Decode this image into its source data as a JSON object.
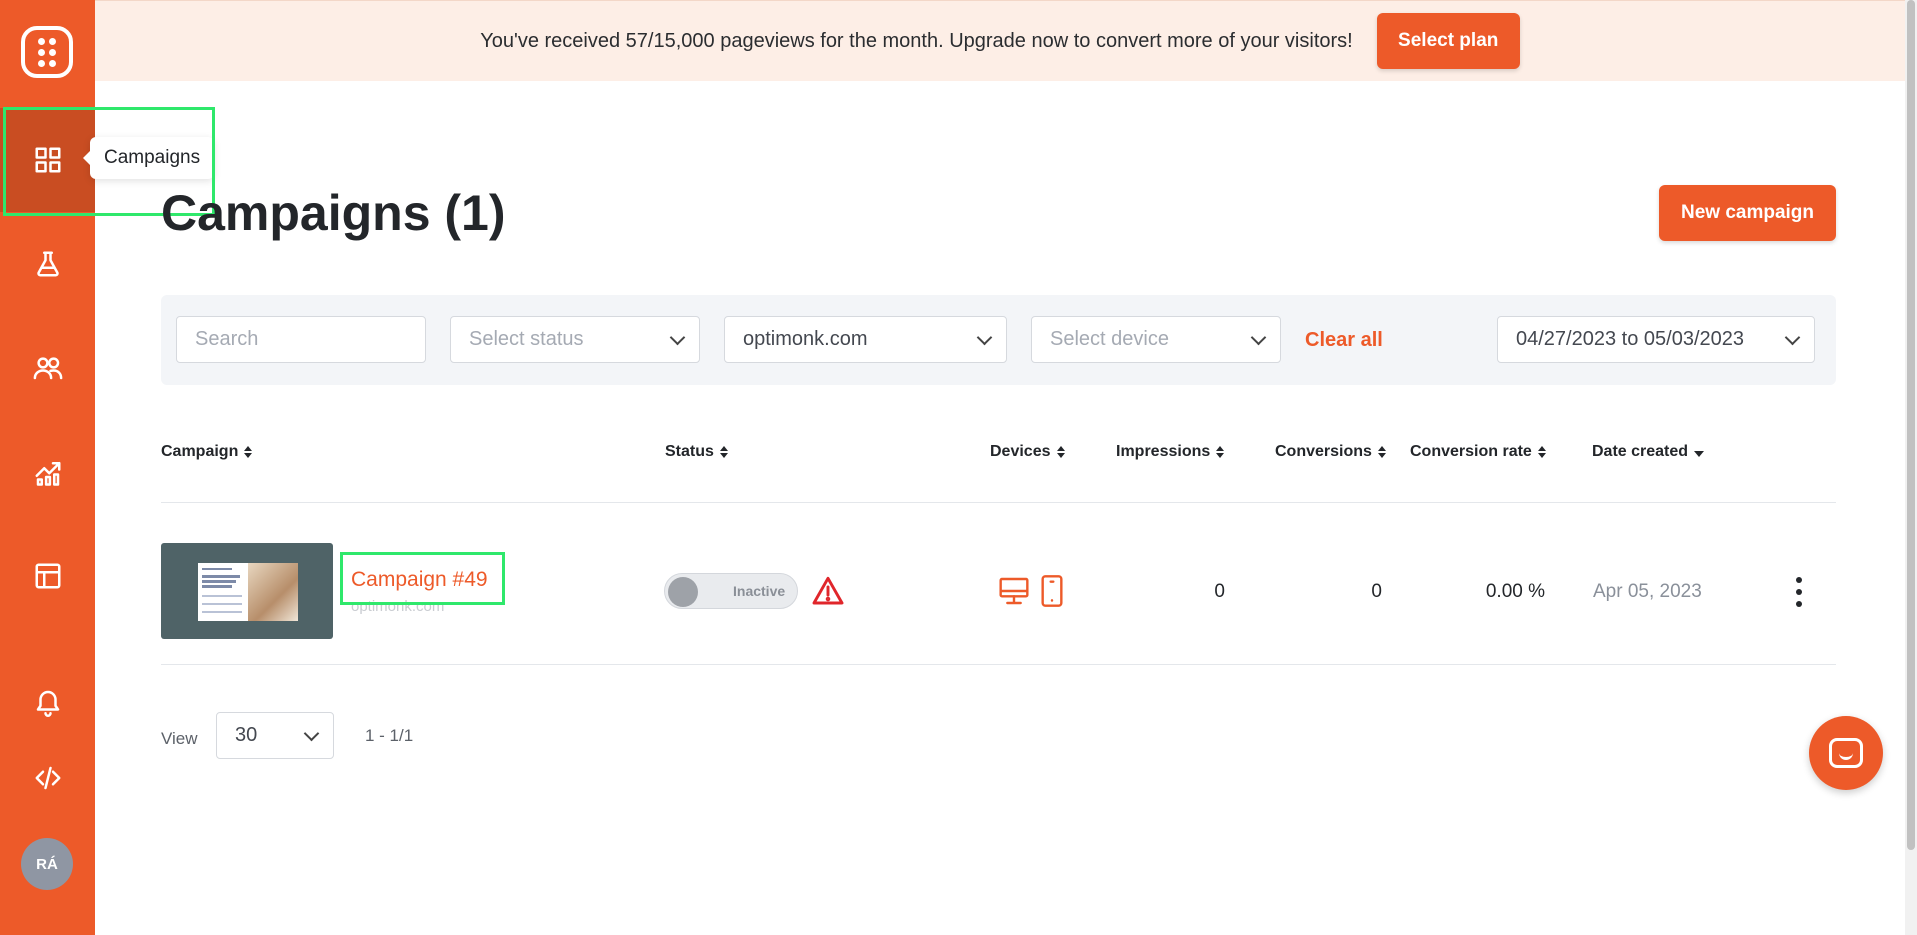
{
  "banner": {
    "message": "You've received 57/15,000 pageviews for the month. Upgrade now to convert more of your visitors!",
    "cta_label": "Select plan"
  },
  "sidebar": {
    "items": [
      {
        "icon": "grid-icon",
        "label": "Campaigns",
        "active": true
      },
      {
        "icon": "flask-icon"
      },
      {
        "icon": "users-icon"
      },
      {
        "icon": "analytics-icon"
      },
      {
        "icon": "layout-icon"
      },
      {
        "icon": "bell-icon"
      },
      {
        "icon": "code-icon"
      }
    ],
    "tooltip": "Campaigns",
    "avatar_initials": "RÁ"
  },
  "header": {
    "title": "Campaigns (1)",
    "new_campaign_label": "New campaign"
  },
  "filters": {
    "search_placeholder": "Search",
    "status_placeholder": "Select status",
    "domain_value": "optimonk.com",
    "device_placeholder": "Select device",
    "clear_all_label": "Clear all",
    "date_range": "04/27/2023 to 05/03/2023"
  },
  "table": {
    "columns": [
      "Campaign",
      "Status",
      "Devices",
      "Impressions",
      "Conversions",
      "Conversion rate",
      "Date created"
    ],
    "rows": [
      {
        "name": "Campaign #49",
        "domain": "optimonk.com",
        "status": "Inactive",
        "devices": [
          "desktop-icon",
          "mobile-icon"
        ],
        "impressions": "0",
        "conversions": "0",
        "conversion_rate": "0.00 %",
        "date_created": "Apr 05, 2023"
      }
    ]
  },
  "pagination": {
    "view_label": "View",
    "per_page": "30",
    "range": "1 - 1/1"
  },
  "colors": {
    "accent": "#ed5a29",
    "sidebar_active": "#c94d22",
    "banner_bg": "#fdeee6",
    "highlight": "#2fe86b",
    "warning": "#e0262b"
  }
}
